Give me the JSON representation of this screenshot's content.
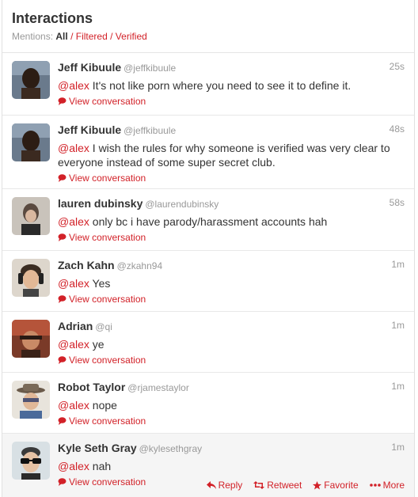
{
  "header": {
    "title": "Interactions",
    "mentions_label": "Mentions:",
    "filter_all": "All",
    "filter_filtered": "Filtered",
    "filter_verified": "Verified",
    "separator": "/"
  },
  "colors": {
    "accent": "#d22128",
    "muted": "#999999",
    "text": "#333333"
  },
  "items": [
    {
      "fullname": "Jeff Kibuule",
      "username": "@jeffkibuule",
      "time": "25s",
      "mention": "@alex",
      "text": " It's not like porn where you need to see it to define it.",
      "convo": "View conversation"
    },
    {
      "fullname": "Jeff Kibuule",
      "username": "@jeffkibuule",
      "time": "48s",
      "mention": "@alex",
      "text": " I wish the rules for why someone is verified was very clear to everyone instead of some super secret club.",
      "convo": "View conversation"
    },
    {
      "fullname": "lauren dubinsky",
      "username": "@laurendubinsky",
      "time": "58s",
      "mention": "@alex",
      "text": " only bc i have parody/harassment accounts hah",
      "convo": "View conversation"
    },
    {
      "fullname": "Zach Kahn",
      "username": "@zkahn94",
      "time": "1m",
      "mention": "@alex",
      "text": " Yes",
      "convo": "View conversation"
    },
    {
      "fullname": "Adrian",
      "username": "@qi",
      "time": "1m",
      "mention": "@alex",
      "text": " ye",
      "convo": "View conversation"
    },
    {
      "fullname": "Robot Taylor",
      "username": "@rjamestaylor",
      "time": "1m",
      "mention": "@alex",
      "text": " nope",
      "convo": "View conversation"
    },
    {
      "fullname": "Kyle Seth Gray",
      "username": "@kylesethgray",
      "time": "1m",
      "mention": "@alex",
      "text": " nah",
      "convo": "View conversation"
    }
  ],
  "actions": {
    "reply": "Reply",
    "retweet": "Retweet",
    "favorite": "Favorite",
    "more": "More"
  }
}
